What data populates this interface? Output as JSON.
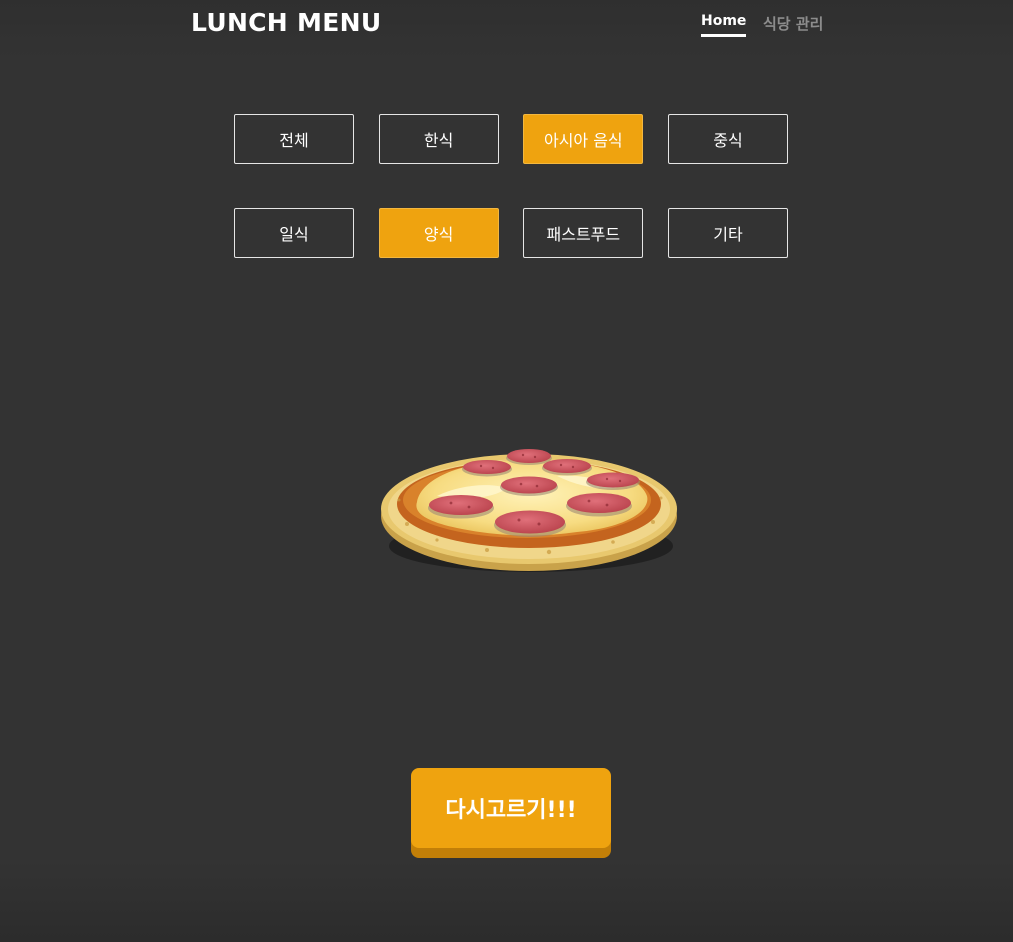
{
  "header": {
    "brand": "LUNCH MENU",
    "nav": [
      {
        "label": "Home",
        "active": true
      },
      {
        "label": "식당 관리",
        "active": false
      }
    ]
  },
  "categories": [
    {
      "label": "전체",
      "selected": false
    },
    {
      "label": "한식",
      "selected": false
    },
    {
      "label": "아시아 음식",
      "selected": true
    },
    {
      "label": "중식",
      "selected": false
    },
    {
      "label": "일식",
      "selected": false
    },
    {
      "label": "양식",
      "selected": true
    },
    {
      "label": "패스트푸드",
      "selected": false
    },
    {
      "label": "기타",
      "selected": false
    }
  ],
  "result": {
    "image_icon": "pepperoni-pizza-icon"
  },
  "actions": {
    "reroll_label": "다시고르기!!!"
  },
  "colors": {
    "background": "#333333",
    "accent": "#efa30f",
    "accent_shadow": "#c27f08",
    "muted_nav": "#8c8c8c"
  }
}
